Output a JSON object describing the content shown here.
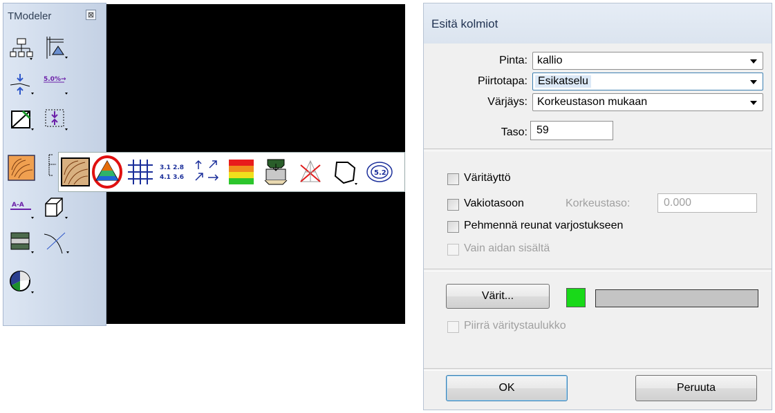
{
  "toolbox": {
    "title": "TModeler",
    "close_glyph": "⊠",
    "tools": [
      {
        "icon": "hierarchy-tree-icon"
      },
      {
        "icon": "surface-section-icon"
      },
      {
        "icon": "point-insert-icon"
      },
      {
        "icon": "slope-percent-icon",
        "text": "5.0%→"
      },
      {
        "icon": "triangle-edit-icon"
      },
      {
        "icon": "elevation-marker-icon"
      },
      {
        "icon": "contour-terrain-icon"
      },
      {
        "icon": "flyout-expand-icon"
      },
      {
        "icon": "section-line-icon",
        "text": "A-A"
      },
      {
        "icon": "3d-box-icon"
      },
      {
        "icon": "layer-stack-icon"
      },
      {
        "icon": "curve-intersect-icon"
      },
      {
        "icon": "globe-shading-icon"
      }
    ]
  },
  "flyout": {
    "tools": [
      {
        "icon": "contour-selected-icon"
      },
      {
        "icon": "display-triangles-icon",
        "highlighted": true
      },
      {
        "icon": "grid-icon"
      },
      {
        "icon": "elevation-labels-icon",
        "text_top": "3.1 2.8",
        "text_bottom": "4.1 3.6"
      },
      {
        "icon": "slope-arrows-icon"
      },
      {
        "icon": "color-bands-icon"
      },
      {
        "icon": "volume-fill-icon"
      },
      {
        "icon": "delete-triangles-icon"
      },
      {
        "icon": "boundary-icon"
      },
      {
        "icon": "label-value-icon",
        "text": "5.2"
      }
    ]
  },
  "dialog": {
    "title": "Esitä kolmiot",
    "fields": {
      "pinta_label": "Pinta:",
      "pinta_value": "kallio",
      "piirtotapa_label": "Piirtotapa:",
      "piirtotapa_value": "Esikatselu",
      "varjays_label": "Värjäys:",
      "varjays_value": "Korkeustason mukaan",
      "taso_label": "Taso:",
      "taso_value": "59"
    },
    "options": {
      "varitaytto": "Väritäyttö",
      "vakiotasoon": "Vakiotasoon",
      "korkeustaso_label": "Korkeustaso:",
      "korkeustaso_value": "0.000",
      "pehmenna": "Pehmennä reunat varjostukseen",
      "vain_aidan": "Vain aidan sisältä"
    },
    "colors": {
      "button": "Värit...",
      "swatch_color": "#19d919",
      "piirra": "Piirrä väritystaulukko"
    },
    "buttons": {
      "ok": "OK",
      "cancel": "Peruuta"
    }
  }
}
